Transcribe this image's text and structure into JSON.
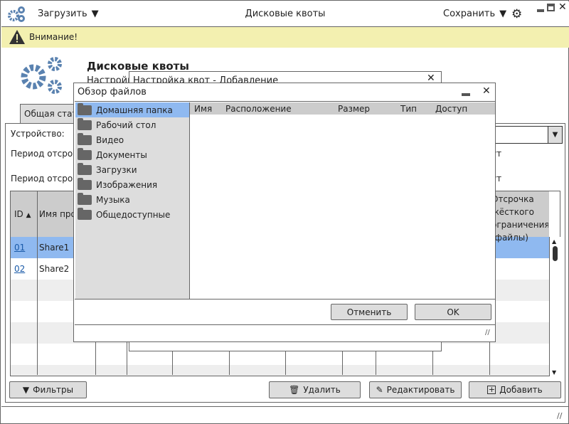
{
  "topbar": {
    "load_label": "Загрузить",
    "title": "Дисковые квоты",
    "save_label": "Сохранить"
  },
  "warning": {
    "text": "Внимание!"
  },
  "page": {
    "title": "Дисковые квоты",
    "subtitle_fragment": "Настройк",
    "tab_fragment": "Общая стат"
  },
  "form": {
    "device_label": "Устройство:",
    "grace1_fragment": "Период отсроч",
    "grace2_fragment": "Период отсроч",
    "grace1_right": "ут",
    "grace2_right": "ут"
  },
  "table": {
    "headers": {
      "id": "ID",
      "name_fragment": "Имя проф",
      "last": "Отсрочка жёсткого ограничения (файлы)"
    },
    "rows": [
      {
        "id": "01",
        "name": "Share1",
        "selected": true
      },
      {
        "id": "02",
        "name": "Share2",
        "selected": false
      }
    ]
  },
  "buttons": {
    "filters": "Фильтры",
    "delete": "Удалить",
    "edit": "Редактировать",
    "add": "Добавить"
  },
  "dialog_quota": {
    "title": "Настройка квот - Добавление"
  },
  "dialog_files": {
    "title": "Обзор файлов",
    "folders": [
      "Домашняя папка",
      "Рабочий стол",
      "Видео",
      "Документы",
      "Загрузки",
      "Изображения",
      "Музыка",
      "Общедоступные"
    ],
    "selected_folder": "Домашняя папка",
    "columns": [
      "Имя",
      "Расположение",
      "Размер",
      "Тип",
      "Доступ"
    ],
    "cancel": "Отменить",
    "ok": "OK"
  },
  "colors": {
    "accent": "#8fb9f0",
    "warning_bg": "#f3f0b0",
    "icon_blue": "#5a82b0"
  }
}
